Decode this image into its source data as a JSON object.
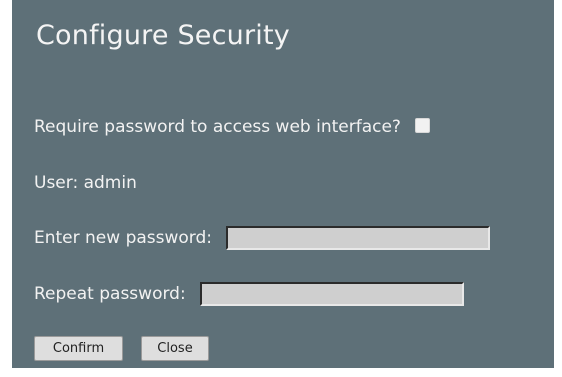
{
  "dialog": {
    "title": "Configure Security",
    "require_password": {
      "label": "Require password to access web interface?",
      "checked": false
    },
    "user": {
      "label": "User: admin"
    },
    "new_password": {
      "label": "Enter new password:",
      "value": ""
    },
    "repeat_password": {
      "label": "Repeat password:",
      "value": ""
    },
    "buttons": {
      "confirm_label": "Confirm",
      "close_label": "Close"
    }
  },
  "colors": {
    "dialog_background": "#5e7078",
    "text": "#f2f2f2",
    "input_background": "#cfcfcf",
    "button_background": "#dedede"
  }
}
